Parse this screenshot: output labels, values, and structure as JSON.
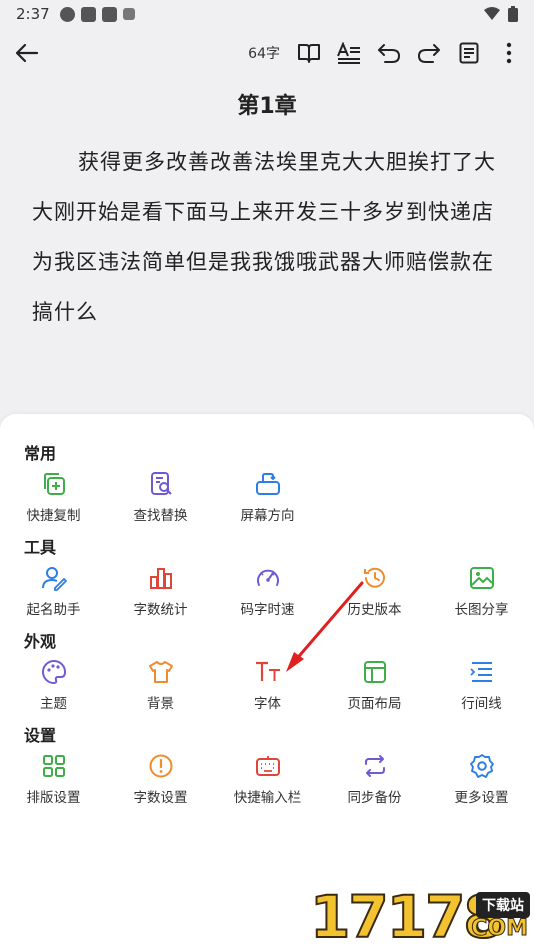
{
  "status": {
    "time": "2:37"
  },
  "toolbar": {
    "word_count": "64字"
  },
  "chapter": {
    "title": "第1章",
    "body": "获得更多改善改善法埃里克大大胆挨打了大大刚开始是看下面马上来开发三十多岁到快递店为我区违法简单但是我我饿哦武器大师赔偿款在搞什么"
  },
  "sections": [
    {
      "title": "常用",
      "items": [
        {
          "label": "快捷复制",
          "icon": "copy-add-icon"
        },
        {
          "label": "查找替换",
          "icon": "find-replace-icon"
        },
        {
          "label": "屏幕方向",
          "icon": "screen-rotate-icon"
        }
      ]
    },
    {
      "title": "工具",
      "items": [
        {
          "label": "起名助手",
          "icon": "name-assistant-icon"
        },
        {
          "label": "字数统计",
          "icon": "word-stats-icon"
        },
        {
          "label": "码字时速",
          "icon": "speedometer-icon"
        },
        {
          "label": "历史版本",
          "icon": "history-icon"
        },
        {
          "label": "长图分享",
          "icon": "image-share-icon"
        }
      ]
    },
    {
      "title": "外观",
      "items": [
        {
          "label": "主题",
          "icon": "palette-icon"
        },
        {
          "label": "背景",
          "icon": "tshirt-icon"
        },
        {
          "label": "字体",
          "icon": "font-icon"
        },
        {
          "label": "页面布局",
          "icon": "layout-icon"
        },
        {
          "label": "行间线",
          "icon": "line-spacing-icon"
        }
      ]
    },
    {
      "title": "设置",
      "items": [
        {
          "label": "排版设置",
          "icon": "grid-layout-icon"
        },
        {
          "label": "字数设置",
          "icon": "alert-circle-icon"
        },
        {
          "label": "快捷输入栏",
          "icon": "keyboard-icon"
        },
        {
          "label": "同步备份",
          "icon": "sync-icon"
        },
        {
          "label": "更多设置",
          "icon": "gear-icon"
        }
      ]
    }
  ],
  "colors": {
    "green": "#3fae49",
    "purple": "#6f5ad6",
    "blue": "#2d7ee6",
    "red": "#e0453a",
    "orange": "#f08c2e"
  },
  "watermark": {
    "digits": "17178",
    "tag": "下载站",
    "suffix": "COM"
  }
}
